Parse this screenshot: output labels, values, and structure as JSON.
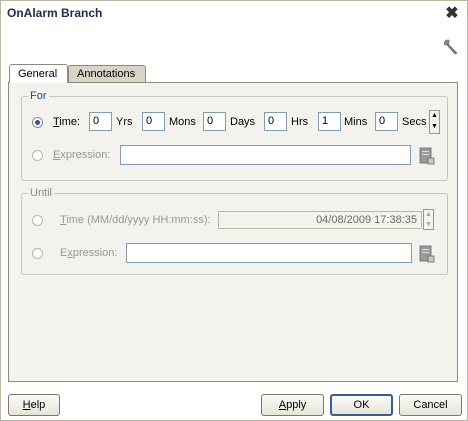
{
  "window": {
    "title": "OnAlarm Branch"
  },
  "tabs": [
    {
      "label": "General",
      "active": true
    },
    {
      "label": "Annotations",
      "active": false
    }
  ],
  "for_group": {
    "legend": "For",
    "time_label": "Time:",
    "expression_label": "Expression:",
    "fields": [
      {
        "value": "0",
        "unit": "Yrs"
      },
      {
        "value": "0",
        "unit": "Mons"
      },
      {
        "value": "0",
        "unit": "Days"
      },
      {
        "value": "0",
        "unit": "Hrs"
      },
      {
        "value": "1",
        "unit": "Mins"
      },
      {
        "value": "0",
        "unit": "Secs"
      }
    ],
    "time_selected": true,
    "expression_value": ""
  },
  "until_group": {
    "legend": "Until",
    "time_label": "Time (MM/dd/yyyy HH:mm:ss):",
    "date_value": "04/08/2009 17:38:35",
    "expression_label": "Expression:",
    "expression_value": ""
  },
  "buttons": {
    "help": "Help",
    "apply": "Apply",
    "ok": "OK",
    "cancel": "Cancel"
  },
  "icons": {
    "close": "close-icon",
    "wrench": "wrench-icon",
    "browse": "browse-icon"
  }
}
